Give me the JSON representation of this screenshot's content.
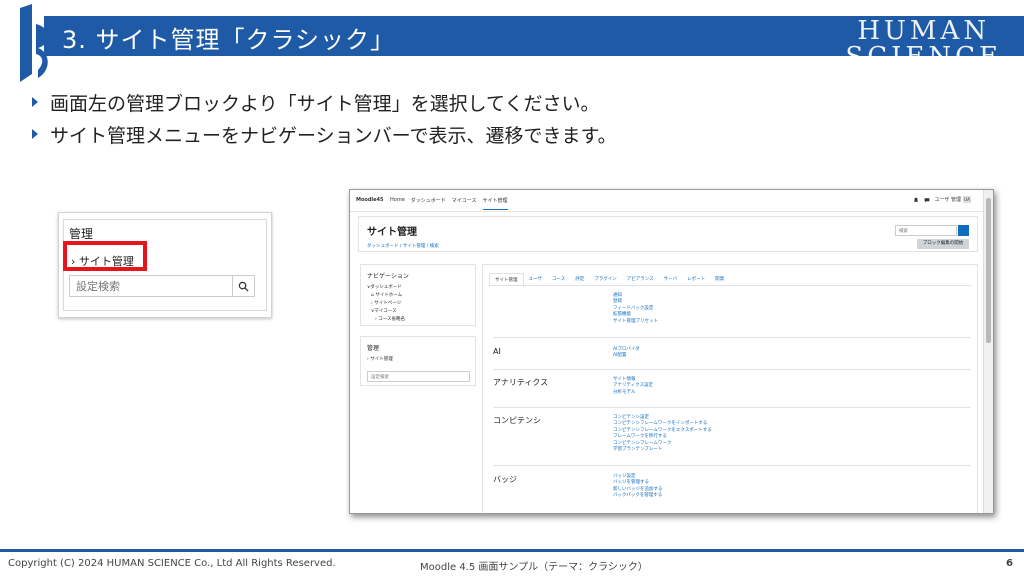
{
  "slide": {
    "title": "3. サイト管理「クラシック」",
    "brand_line1": "HUMAN",
    "brand_line2": "SCIENCE",
    "bullets": [
      "画面左の管理ブロックより「サイト管理」を選択してください。",
      "サイト管理メニューをナビゲーションバーで表示、遷移できます。"
    ],
    "footer_left": "Copyright (C) 2024 HUMAN SCIENCE Co., Ltd All Rights Reserved.",
    "footer_center": "Moodle 4.5 画面サンプル（テーマ：クラシック）",
    "page_number": "6"
  },
  "crop": {
    "heading": "管理",
    "item": "› サイト管理",
    "search_placeholder": "設定検索"
  },
  "moodle": {
    "brand": "Moodle45",
    "nav": [
      "Home",
      "ダッシュボード",
      "マイコース",
      "サイト管理"
    ],
    "user_label": "ユーザ 管理",
    "user_initials": "UA",
    "page_title": "サイト管理",
    "breadcrumb": "ダッシュボード / サイト管理 / 検索",
    "header_search_placeholder": "検索",
    "block_edit_button": "ブロック編集の開始",
    "nav_block": {
      "heading": "ナビゲーション",
      "items": [
        "∨ダッシュボード",
        "⌂ サイトホーム",
        "› サイトページ",
        "∨マイコース",
        "› コース省略名"
      ]
    },
    "admin_block": {
      "heading": "管理",
      "item": "› サイト管理",
      "search_placeholder": "設定検索"
    },
    "tabs": [
      "サイト管理",
      "ユーザ",
      "コース",
      "評定",
      "プラグイン",
      "アピアランス",
      "サーバ",
      "レポート",
      "開発"
    ],
    "sections": [
      {
        "heading": "",
        "links": [
          "通知",
          "登録",
          "フィードバック設定",
          "拡張機能",
          "サイト管理プリセット"
        ]
      },
      {
        "heading": "AI",
        "links": [
          "AIプロバイダ",
          "AI配置"
        ]
      },
      {
        "heading": "アナリティクス",
        "links": [
          "サイト情報",
          "アナリティクス設定",
          "分析モデル"
        ]
      },
      {
        "heading": "コンピテンシ",
        "links": [
          "コンピテンシ設定",
          "コンピテンシフレームワークをインポートする",
          "コンピテンシフレームワークをエクスポートする",
          "フレームワークを移行する",
          "コンピテンシフレームワーク",
          "学習プランテンプレート"
        ]
      },
      {
        "heading": "バッジ",
        "links": [
          "バッジ設定",
          "バッジを管理する",
          "新しいバッジを追加する",
          "バックパックを管理する"
        ]
      }
    ]
  },
  "colors": {
    "banner": "#1f5aa6",
    "highlight": "#e8141c",
    "link": "#0f6cbf"
  }
}
